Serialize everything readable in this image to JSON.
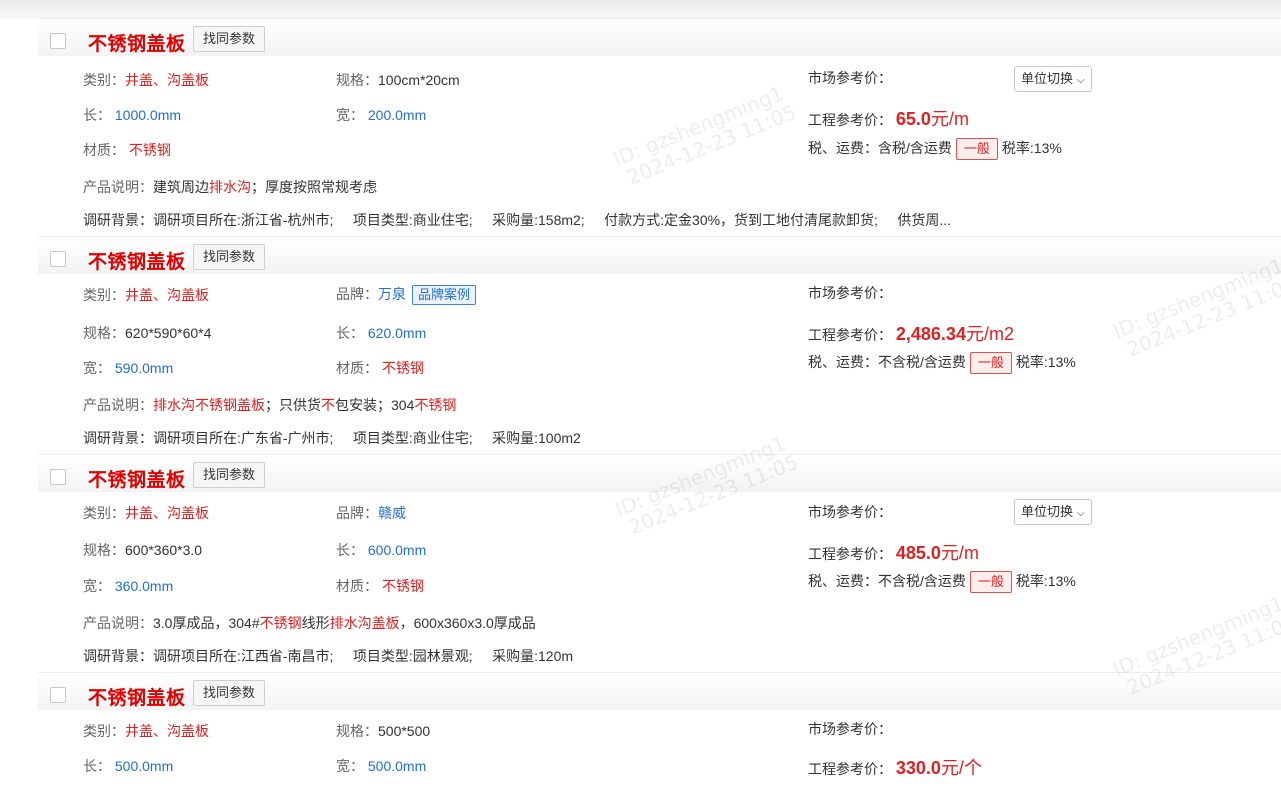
{
  "watermark": {
    "line1": "ID: gzshengming1",
    "line2": "2024-12-23 11:05"
  },
  "labels": {
    "category": "类别：",
    "spec": "规格：",
    "length": "长：",
    "width": "宽：",
    "material": "材质：",
    "brand": "品牌：",
    "desc": "产品说明：",
    "bg": "调研背景：",
    "market": "市场参考价：",
    "project": "工程参考价：",
    "tax": "税、运费：",
    "tax_rate": "税率:13%",
    "find_same": "找同参数",
    "unit_switch": "单位切换",
    "general": "一般",
    "brand_case": "品牌案例"
  },
  "items": [
    {
      "title": "不锈钢盖板",
      "category": [
        "井盖",
        "、",
        "沟盖板"
      ],
      "spec": "100cm*20cm",
      "length": "1000.0mm",
      "width": "200.0mm",
      "material": "不锈钢",
      "price": "65.0",
      "unit": "元/m",
      "tax": "含税/含运费",
      "desc": [
        "建筑周边",
        "排水沟",
        "；厚度按照常规考虑"
      ],
      "bg": "调研项目所在:浙江省-杭州市;     项目类型:商业住宅;     采购量:158m2;     付款方式:定金30%，货到工地付清尾款卸货;     供货周..."
    },
    {
      "title": "不锈钢盖板",
      "category": [
        "井盖",
        "、",
        "沟盖板"
      ],
      "brand": "万泉",
      "spec": "620*590*60*4",
      "length": "620.0mm",
      "width": "590.0mm",
      "material": "不锈钢",
      "price": "2,486.34",
      "unit": "元/m2",
      "tax": "不含税/含运费",
      "desc": [
        "排水沟不锈钢盖板",
        "；只供货",
        "不",
        "包安装；304",
        "不锈钢"
      ],
      "bg": "调研项目所在:广东省-广州市;     项目类型:商业住宅;     采购量:100m2"
    },
    {
      "title": "不锈钢盖板",
      "category": [
        "井盖",
        "、",
        "沟盖板"
      ],
      "brand": "赣威",
      "spec": "600*360*3.0",
      "length": "600.0mm",
      "width": "360.0mm",
      "material": "不锈钢",
      "price": "485.0",
      "unit": "元/m",
      "tax": "不含税/含运费",
      "desc": [
        "3.0厚成品，304#",
        "不锈钢",
        "线形",
        "排水沟盖板",
        "，600x360x3.0厚成品"
      ],
      "bg": "调研项目所在:江西省-南昌市;     项目类型:园林景观;     采购量:120m"
    },
    {
      "title": "不锈钢盖板",
      "category": [
        "井盖",
        "、",
        "沟盖板"
      ],
      "spec": "500*500",
      "length": "500.0mm",
      "width": "500.0mm",
      "price": "330.0",
      "unit": "元/个"
    }
  ],
  "colors": {
    "accent_red": "#e02020",
    "link_blue": "#1f6fd0"
  }
}
